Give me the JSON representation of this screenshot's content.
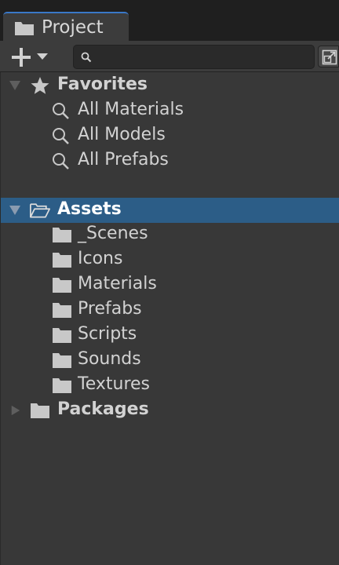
{
  "tab": {
    "label": "Project",
    "icon": "folder-icon"
  },
  "toolbar": {
    "add_icon": "plus-icon",
    "search": {
      "value": "",
      "placeholder": ""
    }
  },
  "tree": {
    "favorites": {
      "label": "Favorites",
      "expanded": true,
      "items": [
        {
          "label": "All Materials",
          "icon": "search-icon"
        },
        {
          "label": "All Models",
          "icon": "search-icon"
        },
        {
          "label": "All Prefabs",
          "icon": "search-icon"
        }
      ]
    },
    "assets": {
      "label": "Assets",
      "expanded": true,
      "selected": true,
      "children": [
        {
          "label": "_Scenes"
        },
        {
          "label": "Icons"
        },
        {
          "label": "Materials"
        },
        {
          "label": "Prefabs"
        },
        {
          "label": "Scripts"
        },
        {
          "label": "Sounds"
        },
        {
          "label": "Textures"
        }
      ]
    },
    "packages": {
      "label": "Packages",
      "expanded": false
    }
  },
  "colors": {
    "background": "#383838",
    "selection": "#2c5d87",
    "tab_accent": "#3a78c8",
    "text": "#d2d2d2"
  }
}
